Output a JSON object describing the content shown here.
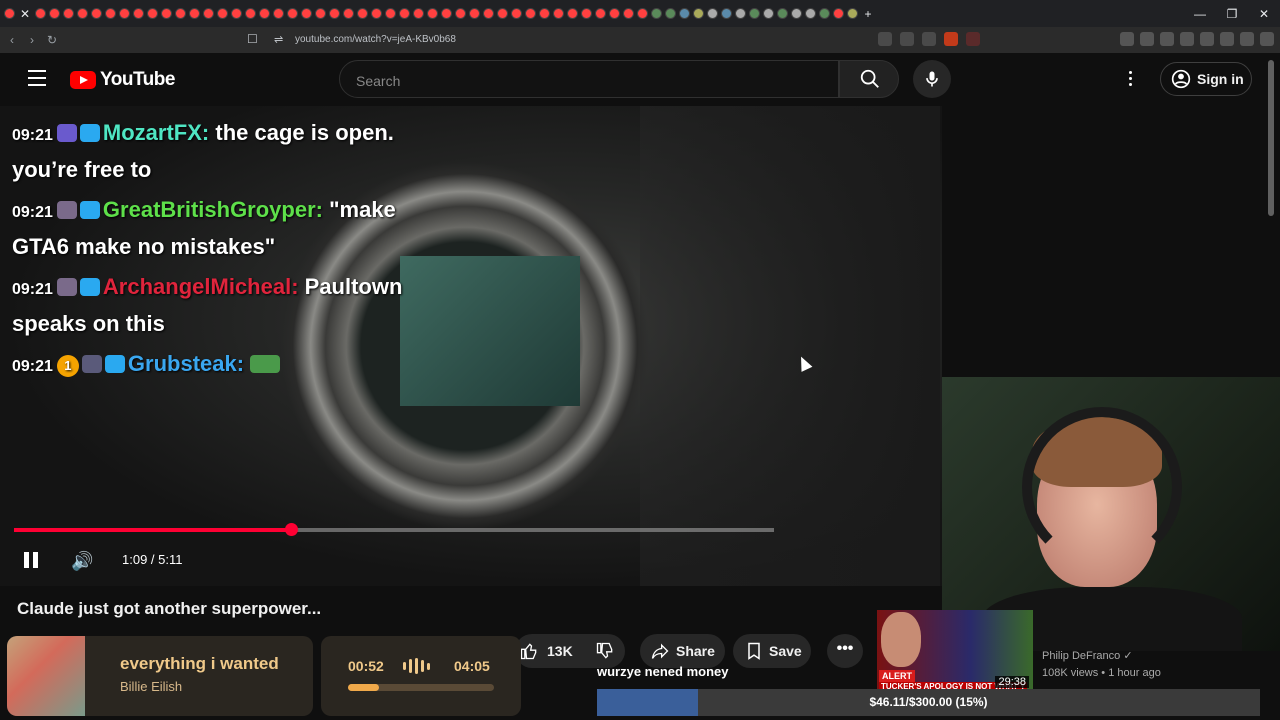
{
  "browser": {
    "url": "youtube.com/watch?v=jeA-KBv0b68",
    "close_tab_glyph": "✕",
    "new_tab_glyph": "+",
    "tab_count": 60
  },
  "youtube": {
    "logo_text": "YouTube",
    "search_placeholder": "Search",
    "sign_in_label": "Sign in"
  },
  "video": {
    "title": "Claude just got another superpower...",
    "time_current": "1:09",
    "time_total": "5:11",
    "time_display": "1:09 / 5:11",
    "progress_fraction": 0.365,
    "like_count": "13K",
    "share_label": "Share",
    "save_label": "Save",
    "more_glyph": "•••"
  },
  "chat": [
    {
      "time": "09:21",
      "user": "MozartFX",
      "text": "the cage is open. you’re free to",
      "color": "#4fe6c3"
    },
    {
      "time": "09:21",
      "user": "GreatBritishGroyper",
      "text": "\"make GTA6 make no mistakes\"",
      "color": "#5ee04a"
    },
    {
      "time": "09:21",
      "user": "ArchangelMicheal",
      "text": "Paultown speaks on this",
      "color": "#e0243c"
    },
    {
      "time": "09:21",
      "user": "Grubsteak",
      "text": "",
      "color": "#3aa7f0",
      "coin": "1"
    }
  ],
  "recommendation": {
    "thumb_alert": "ALERT",
    "thumb_caption": "TUCKER'S APOLOGY IS NOT WHAT Y",
    "duration": "29:38",
    "channel": "Philip DeFranco",
    "meta": "108K views • 1 hour ago"
  },
  "stream_overlay": {
    "ticker": "wurzye nened money",
    "goal_text": "$46.11/$300.00 (15%)",
    "goal_fraction": 0.153,
    "now_playing_title": "everything i wanted",
    "now_playing_artist": "Billie Eilish",
    "np_current": "00:52",
    "np_total": "04:05",
    "np_progress_fraction": 0.21
  },
  "colors": {
    "accent": "#ff0033",
    "yt_red": "#ff0000",
    "np_gold": "#f0c98a"
  }
}
